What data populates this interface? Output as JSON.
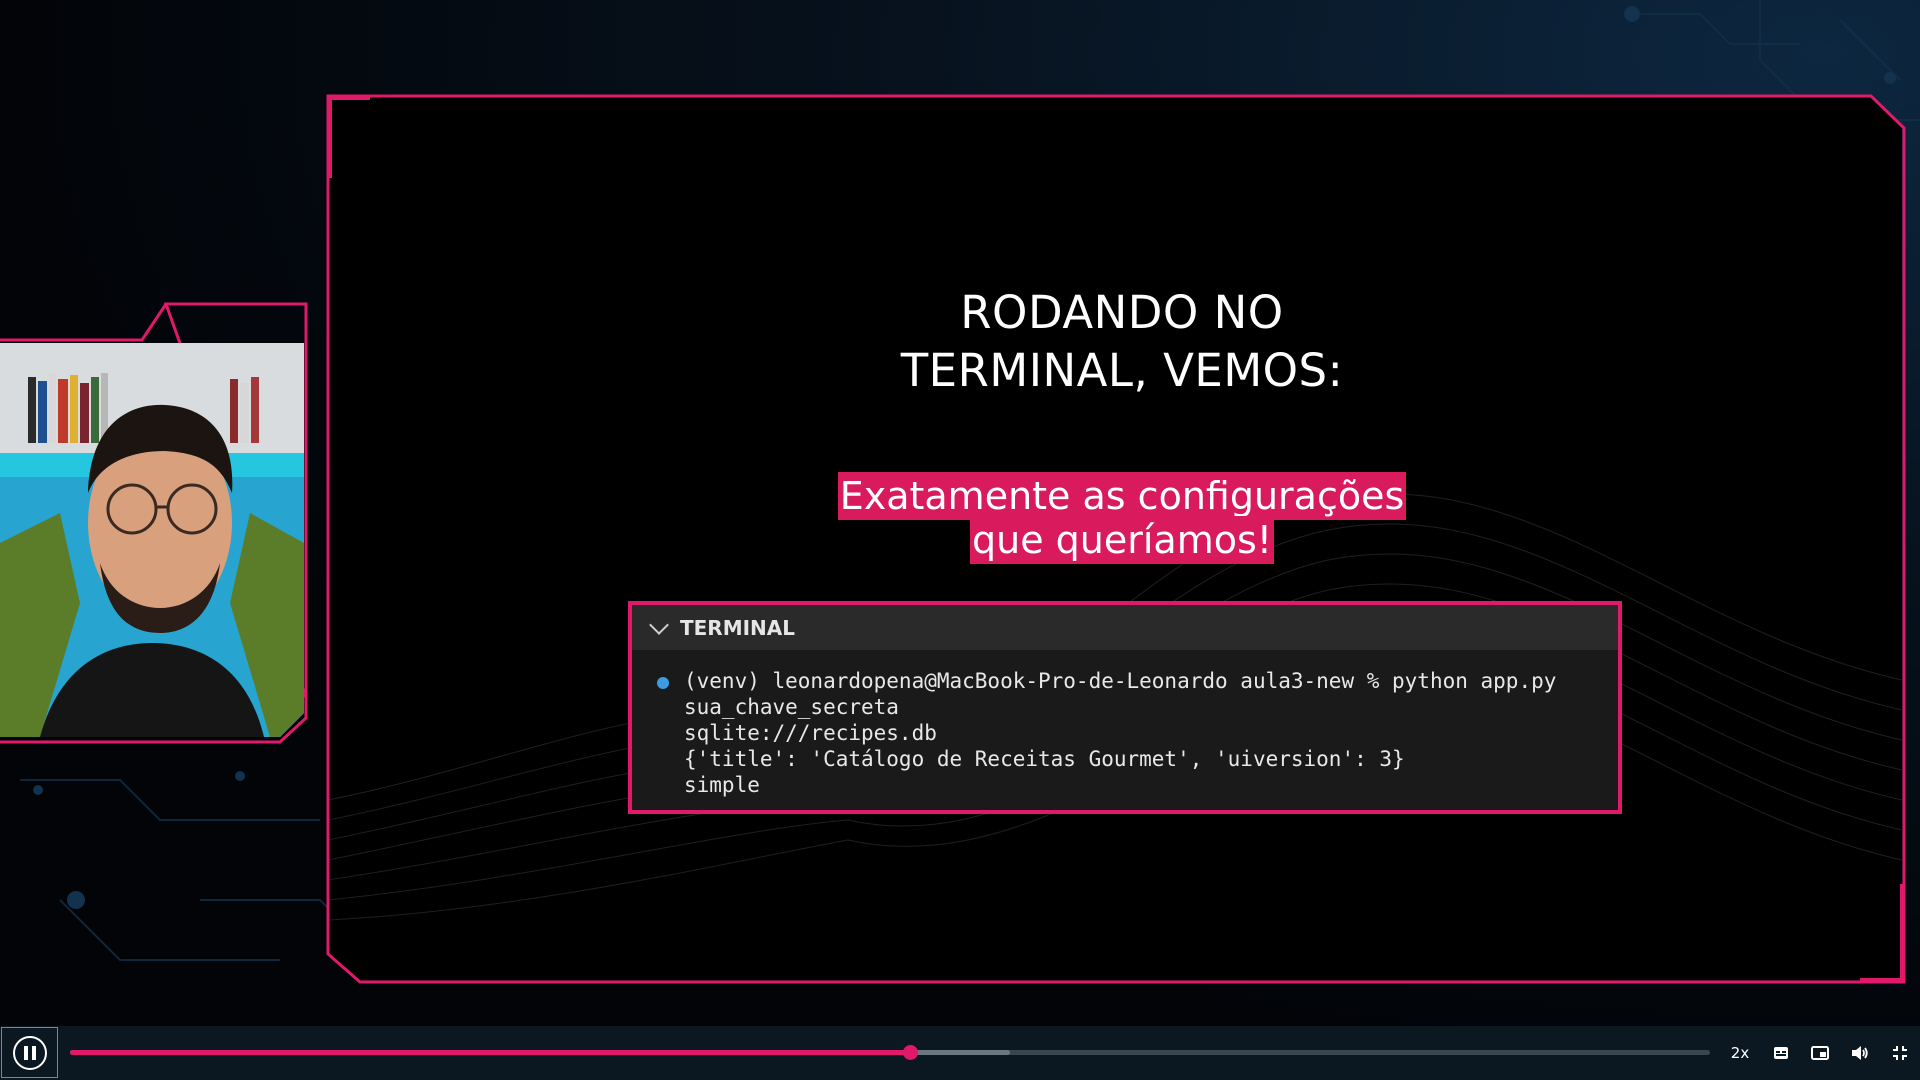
{
  "slide": {
    "title_line1": "RODANDO NO",
    "title_line2": "TERMINAL, VEMOS:",
    "highlight_line1": "Exatamente as configurações",
    "highlight_line2": "que queríamos!"
  },
  "terminal": {
    "header": "TERMINAL",
    "lines": [
      "(venv) leonardopena@MacBook-Pro-de-Leonardo aula3-new % python app.py",
      "sua_chave_secreta",
      "sqlite:///recipes.db",
      "{'title': 'Catálogo de Receitas Gourmet', 'uiversion': 3}",
      "simple"
    ]
  },
  "player": {
    "progress": 0.512,
    "buffered": 0.573,
    "speed_label": "2x",
    "icons": [
      "pause-icon",
      "captions-icon",
      "picture-in-picture-icon",
      "volume-icon",
      "exit-fullscreen-icon"
    ]
  },
  "colors": {
    "accent": "#e0196a",
    "highlight_bg": "#d91a5c",
    "play_border": "#2dbb4c",
    "terminal_dot": "#3d9be0"
  }
}
